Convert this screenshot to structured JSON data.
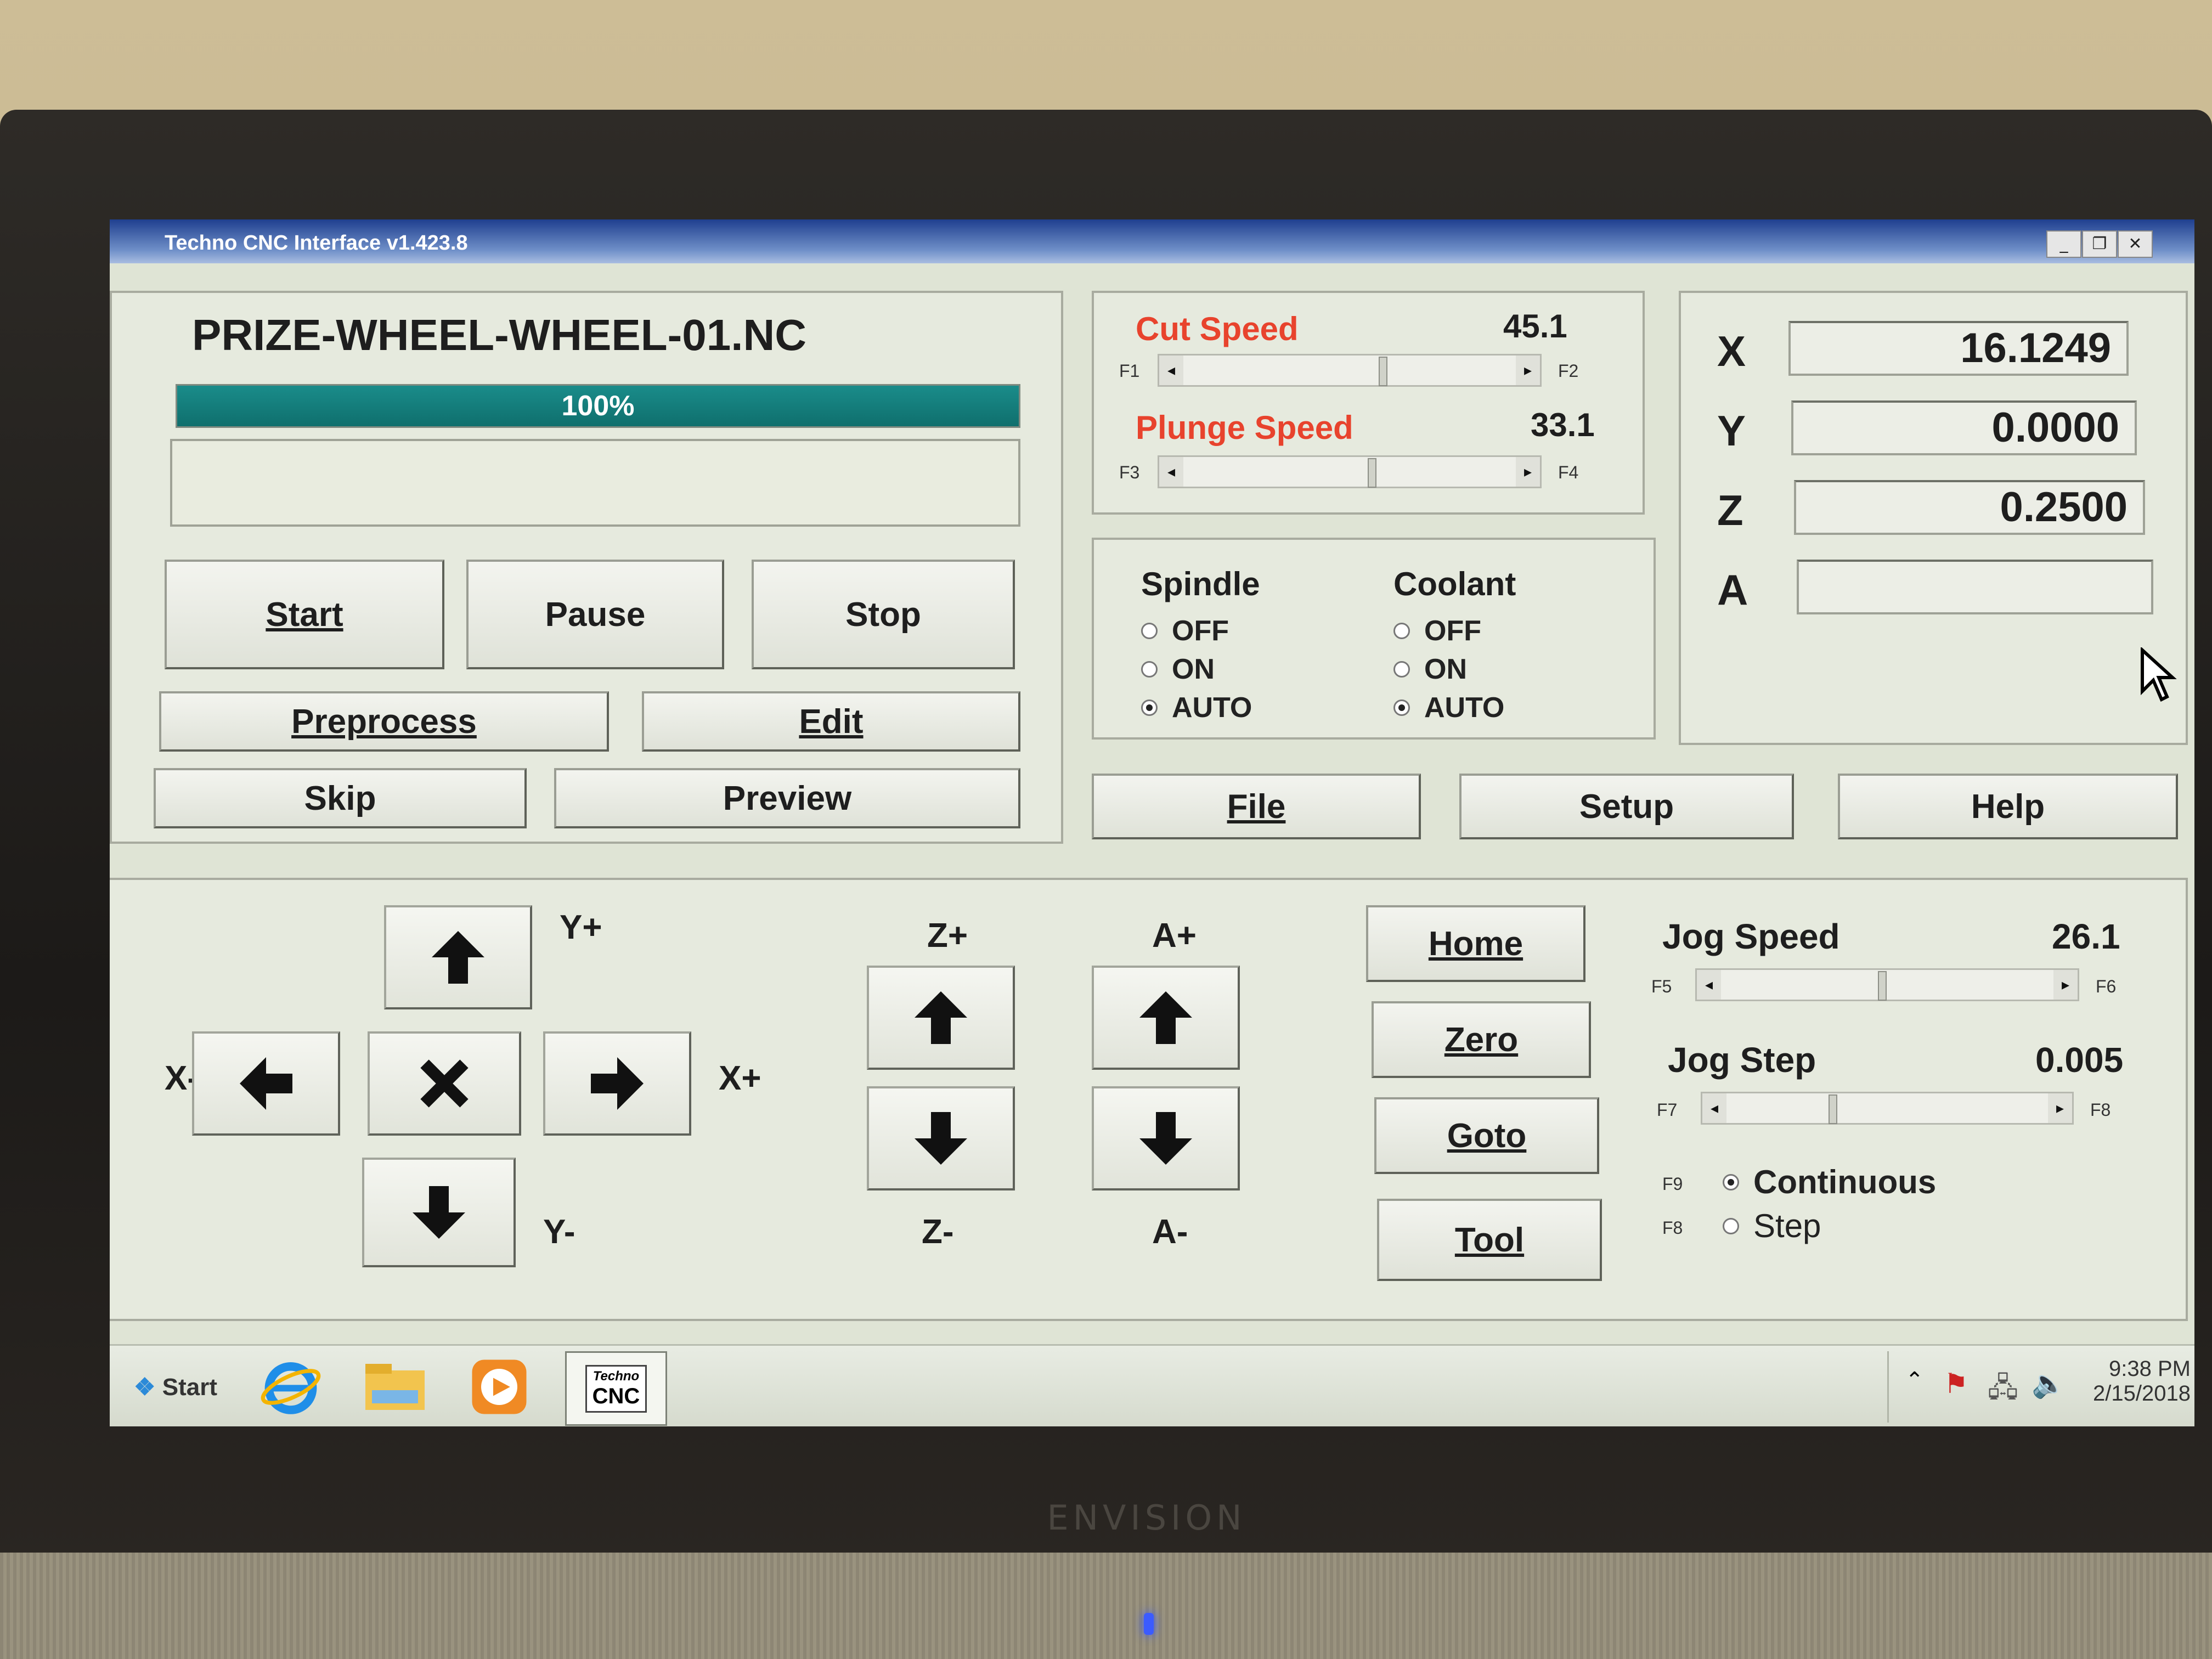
{
  "window": {
    "title": "Techno CNC Interface v1.423.8",
    "buttons": [
      "_",
      "❐",
      "✕"
    ]
  },
  "file": {
    "name": "PRIZE-WHEEL-WHEEL-01.NC",
    "progress_label": "100%",
    "progress_fraction": 1.0
  },
  "job_buttons": {
    "start": "Start",
    "pause": "Pause",
    "stop": "Stop",
    "preprocess": "Preprocess",
    "edit": "Edit",
    "skip": "Skip",
    "preview": "Preview"
  },
  "speeds": {
    "cut": {
      "label": "Cut Speed",
      "value": "45.1",
      "key_left": "F1",
      "key_right": "F2"
    },
    "plunge": {
      "label": "Plunge Speed",
      "value": "33.1",
      "key_left": "F3",
      "key_right": "F4"
    }
  },
  "spindle": {
    "label": "Spindle",
    "options": [
      "OFF",
      "ON",
      "AUTO"
    ],
    "selected": "AUTO"
  },
  "coolant": {
    "label": "Coolant",
    "options": [
      "OFF",
      "ON",
      "AUTO"
    ],
    "selected": "AUTO"
  },
  "menu": {
    "file": "File",
    "setup": "Setup",
    "help": "Help"
  },
  "coords": {
    "x": {
      "label": "X",
      "value": "16.1249"
    },
    "y": {
      "label": "Y",
      "value": "0.0000"
    },
    "z": {
      "label": "Z",
      "value": "0.2500"
    },
    "a": {
      "label": "A",
      "value": ""
    }
  },
  "jog_labels": {
    "y_plus": "Y+",
    "y_minus": "Y-",
    "x_plus": "X+",
    "x_minus": "X-",
    "z_plus": "Z+",
    "z_minus": "Z-",
    "a_plus": "A+",
    "a_minus": "A-"
  },
  "actions": {
    "home": "Home",
    "zero": "Zero",
    "goto": "Goto",
    "tool": "Tool"
  },
  "jog": {
    "speed": {
      "label": "Jog Speed",
      "value": "26.1",
      "key_left": "F5",
      "key_right": "F6"
    },
    "step": {
      "label": "Jog Step",
      "value": "0.005",
      "key_left": "F7",
      "key_right": "F8"
    },
    "mode_continuous": {
      "key": "F9",
      "label": "Continuous"
    },
    "mode_step": {
      "key": "F8",
      "label": "Step"
    },
    "mode_selected": "Continuous"
  },
  "taskbar": {
    "start": "Start",
    "cnc_icon_top": "Techno",
    "cnc_icon_bottom": "CNC",
    "time": "9:38 PM",
    "date": "2/15/2018"
  },
  "monitor": {
    "brand": "ENVISION"
  }
}
